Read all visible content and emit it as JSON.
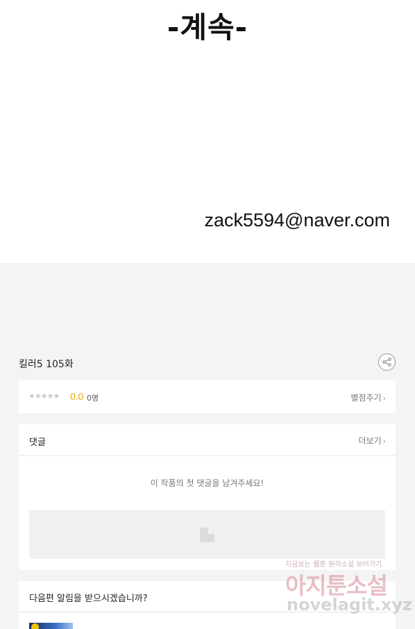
{
  "comic": {
    "continued_text": "-계속-",
    "contact_email": "zack5594@naver.com"
  },
  "episode": {
    "title": "킬러5 105화",
    "share_icon": "share-icon"
  },
  "rating": {
    "stars": "★★★★★",
    "score": "0.0",
    "rater_count": "0명",
    "rate_link": "별점주기"
  },
  "comments": {
    "title": "댓글",
    "more_link": "더보기",
    "empty_message": "이 작품의 첫 댓글을 남겨주세요!"
  },
  "notify": {
    "question": "다음편 알림을 받으시겠습니까?"
  },
  "watermark": {
    "top_line": "지금보는 웹툰 원작소설 보러가기",
    "main": "아지툰소설",
    "url": "novelagit.xyz"
  },
  "colors": {
    "score": "#f0a800",
    "background": "#f4f4f4",
    "watermark_pink": "#d98a98"
  }
}
